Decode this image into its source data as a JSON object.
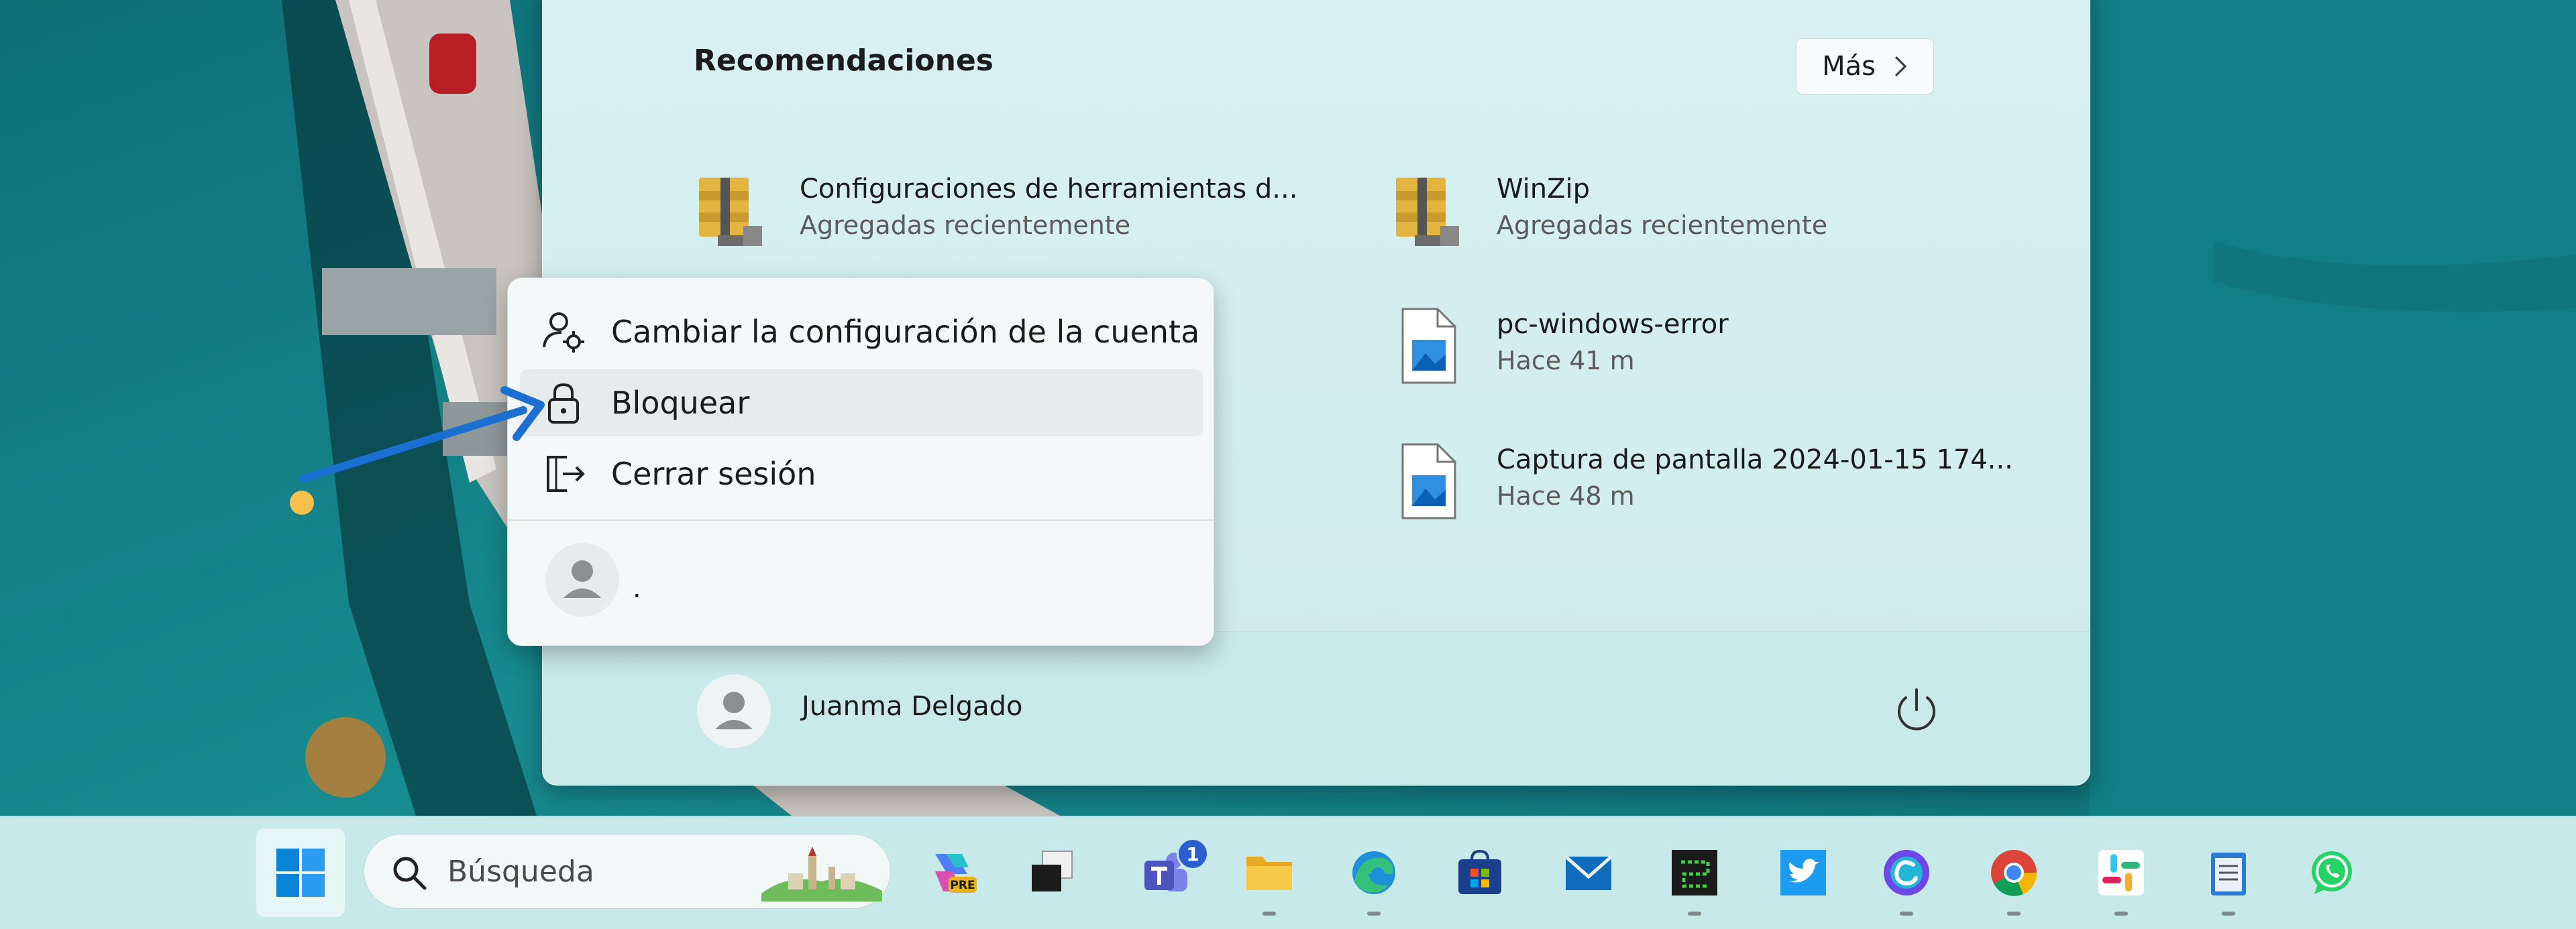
{
  "start_menu": {
    "recommendations_title": "Recomendaciones",
    "more_label": "Más",
    "items": [
      {
        "name": "Configuraciones de herramientas d...",
        "sub": "Agregadas recientemente",
        "icon": "archive-icon"
      },
      {
        "name": "WinZip",
        "sub": "Agregadas recientemente",
        "icon": "archive-icon"
      },
      {
        "name": "pc-windows-error",
        "sub": "Hace 41 m",
        "icon": "image-file-icon"
      },
      {
        "name": "Captura de pantalla 2024-01-15 174...",
        "sub": "Hace 48 m",
        "icon": "image-file-icon"
      }
    ],
    "user_name": "Juanma Delgado"
  },
  "context_menu": {
    "items": [
      {
        "label": "Cambiar la configuración de la cuenta",
        "icon": "user-settings-icon"
      },
      {
        "label": "Bloquear",
        "icon": "lock-icon"
      },
      {
        "label": "Cerrar sesión",
        "icon": "sign-out-icon"
      }
    ],
    "other_user": "."
  },
  "taskbar": {
    "search_placeholder": "Búsqueda",
    "copilot_badge": "PRE",
    "teams_badge": "1",
    "apps": [
      "start",
      "search",
      "copilot",
      "task-view",
      "teams",
      "file-explorer",
      "edge",
      "store",
      "mail",
      "terminal",
      "twitter",
      "canva",
      "chrome",
      "slack",
      "notepad",
      "whatsapp"
    ]
  },
  "colors": {
    "accent": "#0067c0",
    "annotation_arrow": "#1a6fd1",
    "menu_bg": "#f4f8f8",
    "taskbar_bg": "#c8e9ea"
  }
}
